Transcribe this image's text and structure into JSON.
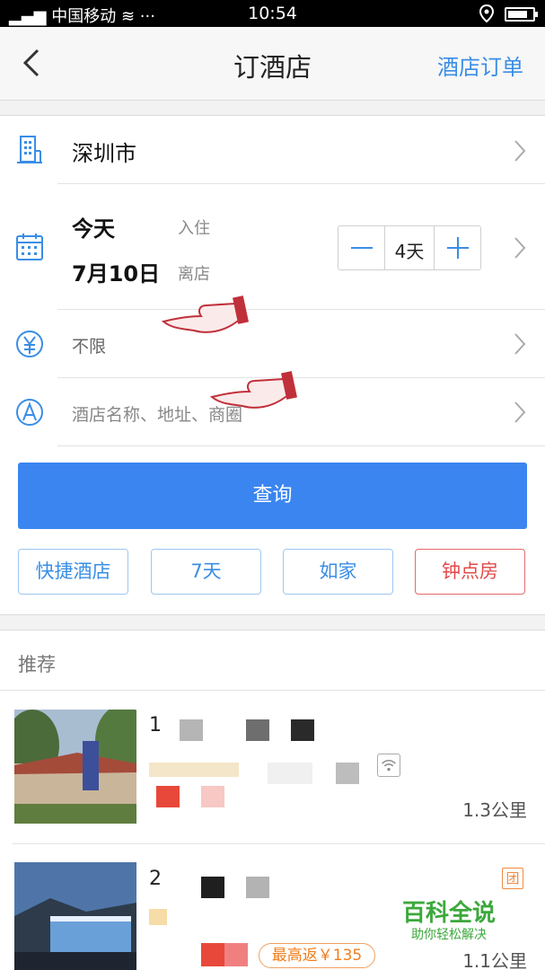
{
  "status_bar": {
    "carrier": "中国移动",
    "time": "10:54",
    "icons": [
      "signal-icon",
      "wifi-icon",
      "more-icon",
      "location-icon",
      "battery-icon"
    ]
  },
  "nav": {
    "title": "订酒店",
    "right_link": "酒店订单",
    "back_icon": "back-chevron-icon"
  },
  "form": {
    "city": "深圳市",
    "checkin": {
      "day": "今天",
      "label": "入住"
    },
    "checkout": {
      "day": "7月10日",
      "label": "离店"
    },
    "nights": "4天",
    "price_filter": "不限",
    "keyword_placeholder": "酒店名称、地址、商圈",
    "search_button": "查询",
    "quick_tags": [
      "快捷酒店",
      "7天",
      "如家",
      "钟点房"
    ]
  },
  "recommend": {
    "header": "推荐",
    "hotels": [
      {
        "index": "1",
        "distance": "1.3公里"
      },
      {
        "index": "2",
        "distance": "1.1公里",
        "rebate": "最高返￥135",
        "badge": "团"
      }
    ]
  },
  "watermark": {
    "title": "百科全说",
    "subtitle": "助你轻松解决"
  },
  "colors": {
    "accent": "#3b85f0",
    "link": "#3a8ee6",
    "red_tag": "#e24a4a",
    "rebate": "#f07d1a",
    "watermark": "#3ca83c"
  }
}
